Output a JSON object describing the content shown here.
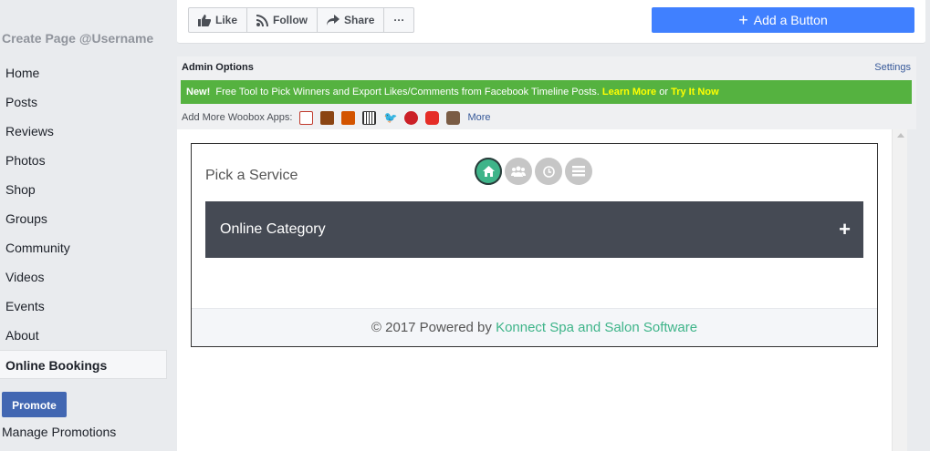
{
  "sidebar": {
    "create_page": "Create Page @Username",
    "items": [
      {
        "label": "Home"
      },
      {
        "label": "Posts"
      },
      {
        "label": "Reviews"
      },
      {
        "label": "Photos"
      },
      {
        "label": "Shop"
      },
      {
        "label": "Groups"
      },
      {
        "label": "Community"
      },
      {
        "label": "Videos"
      },
      {
        "label": "Events"
      },
      {
        "label": "About"
      },
      {
        "label": "Online Bookings",
        "active": true
      }
    ],
    "promote_label": "Promote",
    "manage_promotions_label": "Manage Promotions"
  },
  "action_bar": {
    "like_label": "Like",
    "follow_label": "Follow",
    "share_label": "Share",
    "more_label": "···",
    "add_button_label": "Add a Button"
  },
  "admin": {
    "title": "Admin Options",
    "settings_label": "Settings",
    "new_tag": "New!",
    "promo_text": "Free Tool to Pick Winners and Export Likes/Comments from Facebook Timeline Posts.",
    "learn_more": "Learn More",
    "or_text": "or",
    "try_it_now": "Try It Now",
    "apps_label": "Add More Woobox Apps:",
    "apps": [
      "coupon-icon",
      "photo-contest-icon",
      "sweepstakes-icon",
      "barcode-icon",
      "twitter-icon",
      "pinterest-icon",
      "youtube-icon",
      "instagram-icon"
    ],
    "more_label": "More"
  },
  "booking": {
    "pick_label": "Pick a Service",
    "steps": [
      "home-icon",
      "group-icon",
      "clock-icon",
      "list-icon"
    ],
    "category_label": "Online Category",
    "footer_prefix": "© 2017 Powered by",
    "footer_brand": "Konnect Spa and Salon Software"
  },
  "colors": {
    "facebook_blue": "#4267b2",
    "add_button_blue": "#4080ff",
    "woobox_green": "#55b240",
    "konnect_green": "#3eb489",
    "category_dark": "#454a54"
  }
}
